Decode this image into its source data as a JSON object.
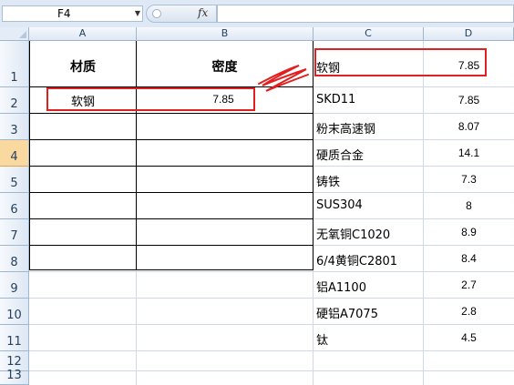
{
  "formula_bar": {
    "name_box": "F4",
    "fx_label": "fx",
    "content": ""
  },
  "columns": [
    "A",
    "B",
    "C",
    "D"
  ],
  "rows": [
    "1",
    "2",
    "3",
    "4",
    "5",
    "6",
    "7",
    "8",
    "9",
    "10",
    "11",
    "12",
    "13"
  ],
  "selected_row": "4",
  "table_left": {
    "header_material": "材质",
    "header_density": "密度",
    "row_material": "软钢",
    "row_density": "7.85"
  },
  "materials": [
    {
      "name": "软钢",
      "density": "7.85"
    },
    {
      "name": "SKD11",
      "density": "7.85"
    },
    {
      "name": "粉末高速钢",
      "density": "8.07"
    },
    {
      "name": "硬质合金",
      "density": "14.1"
    },
    {
      "name": "铸铁",
      "density": "7.3"
    },
    {
      "name": "SUS304",
      "density": "8"
    },
    {
      "name": "无氧铜C1020",
      "density": "8.9"
    },
    {
      "name": "6/4黄铜C2801",
      "density": "8.4"
    },
    {
      "name": "铝A1100",
      "density": "2.7"
    },
    {
      "name": "硬铝A7075",
      "density": "2.8"
    },
    {
      "name": "钛",
      "density": "4.5"
    }
  ],
  "colors": {
    "annotation": "#e02020",
    "selected_row_header": "#f9d99f",
    "header_bg": "#dde7f3"
  }
}
